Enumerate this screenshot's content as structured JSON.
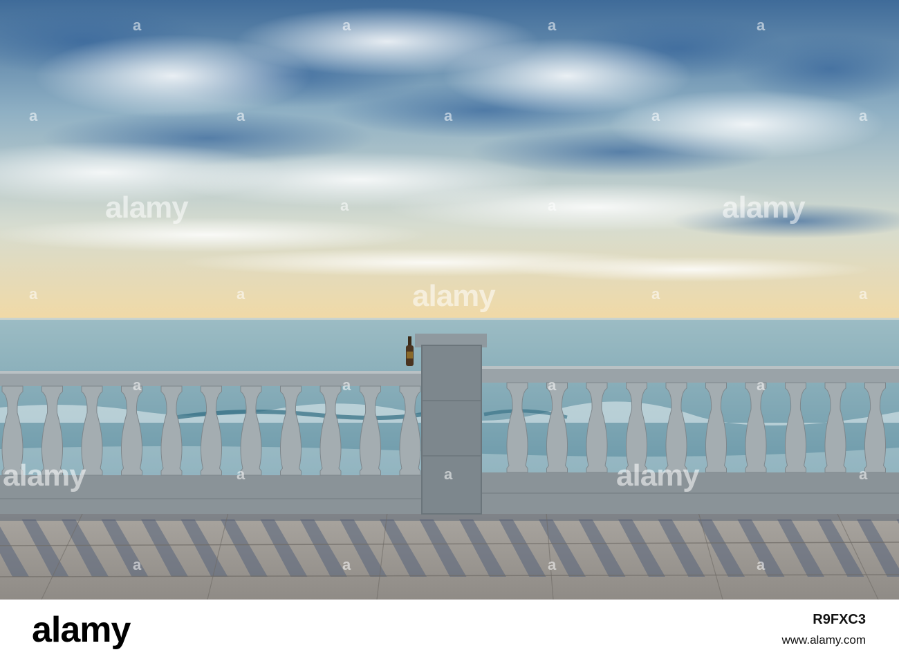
{
  "photo": {
    "description_icons": [
      "sea-horizon",
      "balustrade",
      "bottle",
      "clouds"
    ],
    "colors": {
      "sky_top": "#3e6ea0",
      "sky_mid": "#9fb8c8",
      "sky_horizon": "#f0d9a8",
      "sea": "#7aa6b4",
      "balustrade": "#9ea7ab",
      "balustrade_shadow": "#4d5a66",
      "pavement": "#b9b3aa",
      "pavement_shadow": "#5d6a7a"
    }
  },
  "watermark": {
    "text": "alamy",
    "dot": "a"
  },
  "footer": {
    "logo": "alamy",
    "image_id": "R9FXC3",
    "site": "www.alamy.com"
  }
}
